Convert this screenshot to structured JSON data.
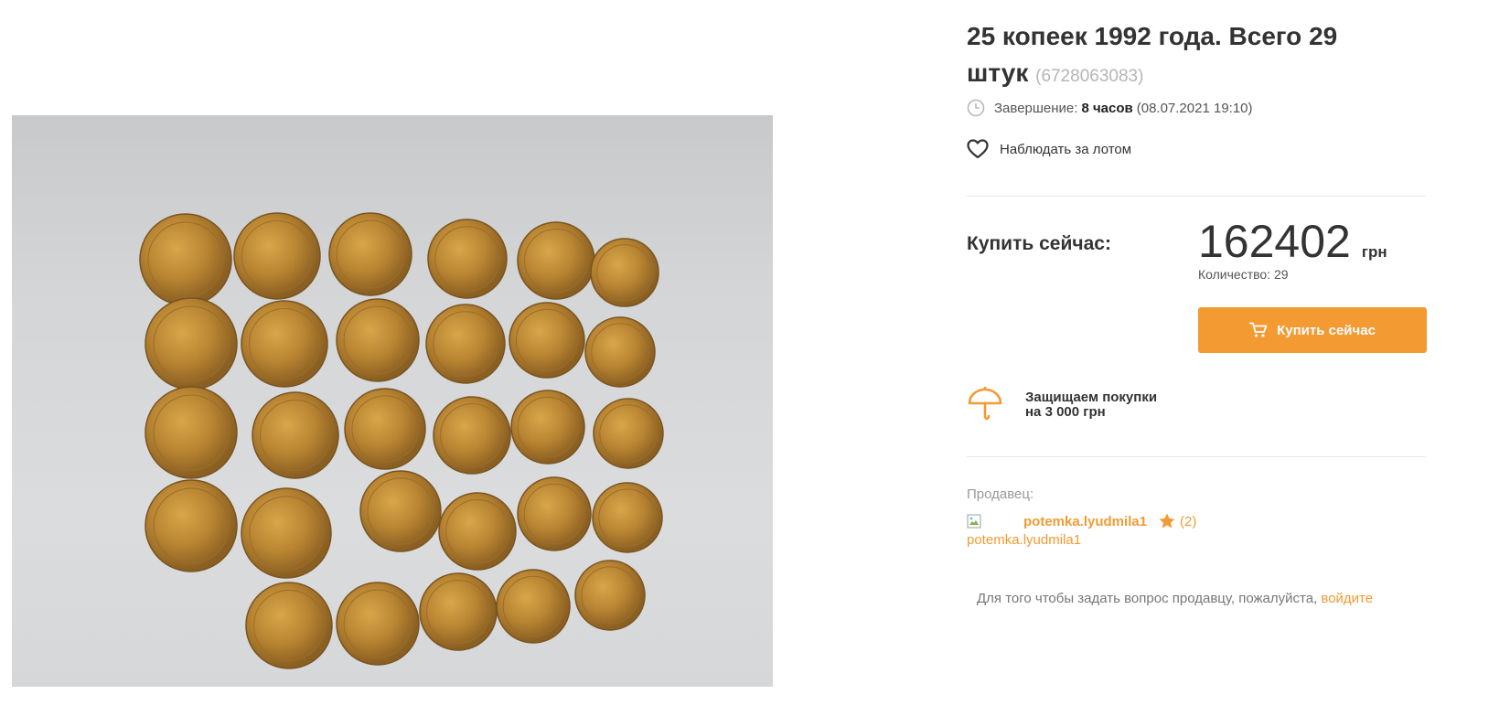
{
  "lot": {
    "title": "25 копеек 1992 года. Всего 29 штук",
    "id": "(6728063083)",
    "end_label": "Завершение:",
    "end_remaining": "8 часов",
    "end_datetime": "(08.07.2021 19:10)",
    "watch_label": "Наблюдать за лотом"
  },
  "buy": {
    "label": "Купить сейчас:",
    "price": "162402",
    "currency": "грн",
    "quantity": "Количество: 29",
    "button_label": "Купить сейчас"
  },
  "protection": {
    "line1": "Защищаем покупки",
    "line2": "на 3 000 грн"
  },
  "seller": {
    "label": "Продавец:",
    "name": "potemka.lyudmila1",
    "rating": "(2)",
    "avatar_alt": "potemka.lyudmila1"
  },
  "question": {
    "text": "Для того чтобы задать вопрос продавцу, пожалуйста,",
    "link": "войдите"
  },
  "colors": {
    "accent": "#f39a32",
    "text": "#333333",
    "muted": "#9a9a9a"
  },
  "icons": [
    "clock-icon",
    "heart-icon",
    "cart-icon",
    "umbrella-icon",
    "star-icon",
    "broken-image-icon"
  ]
}
